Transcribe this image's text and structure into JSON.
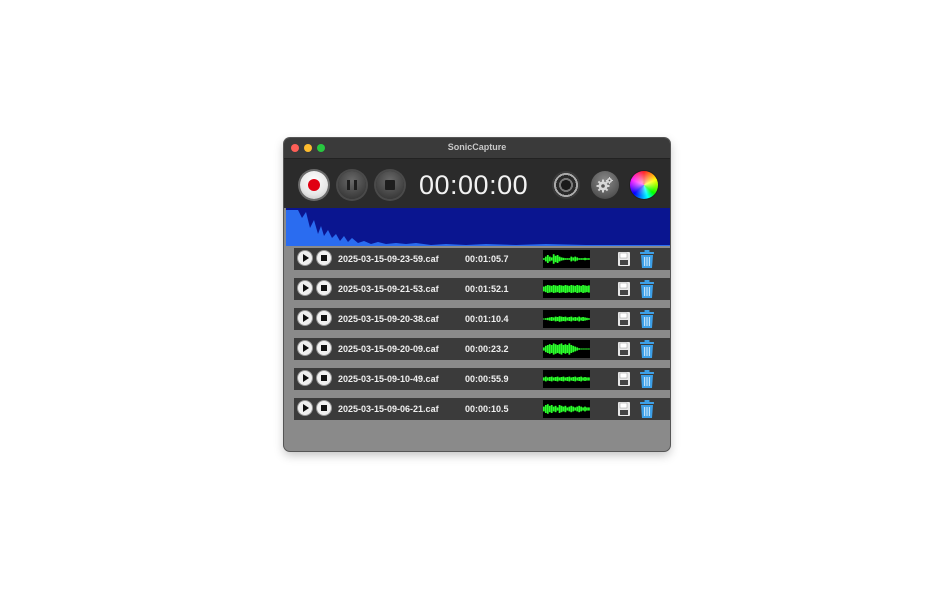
{
  "window": {
    "title": "SonicCapture"
  },
  "toolbar": {
    "timer": "00:00:00"
  },
  "recordings": [
    {
      "filename": "2025-03-15-09-23-59.caf",
      "duration": "00:01:05.7"
    },
    {
      "filename": "2025-03-15-09-21-53.caf",
      "duration": "00:01:52.1"
    },
    {
      "filename": "2025-03-15-09-20-38.caf",
      "duration": "00:01:10.4"
    },
    {
      "filename": "2025-03-15-09-20-09.caf",
      "duration": "00:00:23.2"
    },
    {
      "filename": "2025-03-15-09-10-49.caf",
      "duration": "00:00:55.9"
    },
    {
      "filename": "2025-03-15-09-06-21.caf",
      "duration": "00:00:10.5"
    }
  ],
  "colors": {
    "meter_background": "#0a1590",
    "meter_fill": "#2a6cf0",
    "waveform": "#2bff2b",
    "record_dot": "#e00012",
    "trash": "#3da0e8"
  },
  "icons": {
    "record": "record-icon",
    "pause": "pause-icon",
    "stop": "stop-icon",
    "speaker": "speaker-icon",
    "settings": "gear-icon",
    "color": "color-wheel-icon",
    "row_play": "play-icon",
    "row_stop": "stop-icon",
    "save": "floppy-disk-icon",
    "delete": "trash-icon"
  }
}
